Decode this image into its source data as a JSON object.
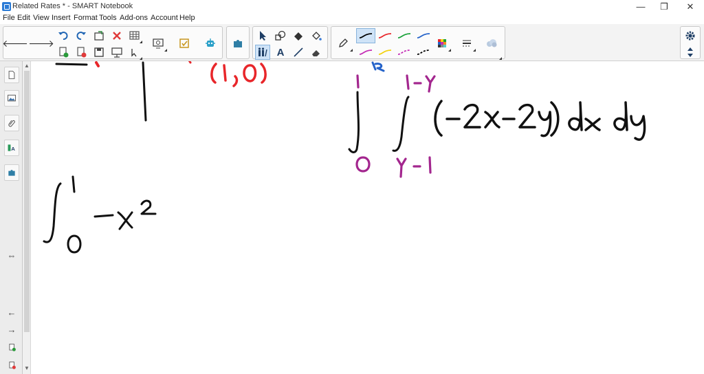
{
  "window": {
    "title": "Related Rates * - SMART Notebook",
    "minimize_glyph": "—",
    "restore_glyph": "❐",
    "close_glyph": "✕"
  },
  "menu": {
    "items": [
      "File",
      "Edit",
      "View",
      "Insert",
      "Format",
      "Tools",
      "Add-ons",
      "Account",
      "Help"
    ]
  },
  "toolbar": {
    "text_tool_glyph": "A",
    "pen_colors": {
      "black": "#000000",
      "red": "#e8262a",
      "green": "#1aa23a",
      "blue": "#2462c9",
      "magenta": "#c42bb5",
      "yellow": "#f3d20e"
    },
    "active_pen": "black"
  },
  "sidebar": {
    "resize_glyph": "⇔",
    "back_glyph": "←",
    "forward_glyph": "→"
  },
  "canvas": {
    "ink_red": "#e8262a",
    "ink_purple": "#a3268e",
    "ink_black": "#111111"
  }
}
